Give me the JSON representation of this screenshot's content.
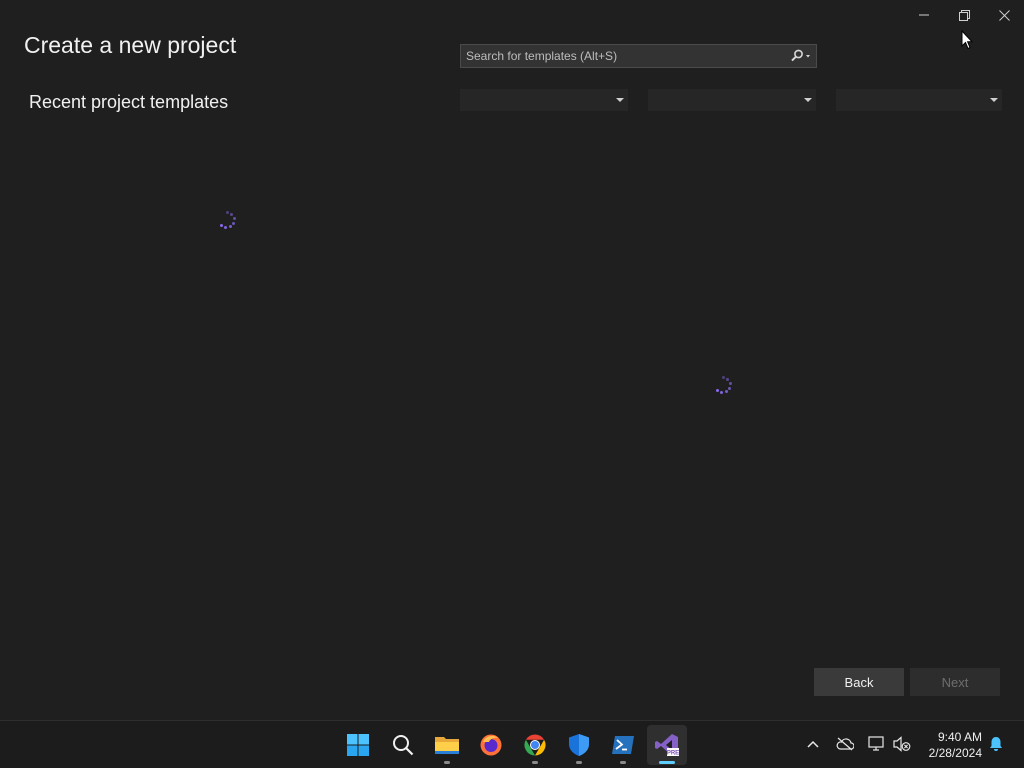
{
  "window": {
    "title": "Create a new project",
    "controls": {
      "minimize": "minimize-icon",
      "restore": "restore-icon",
      "close": "close-icon"
    }
  },
  "recent": {
    "heading": "Recent project templates"
  },
  "search": {
    "placeholder": "Search for templates (Alt+S)",
    "value": ""
  },
  "filters": [
    {
      "name": "language-filter",
      "selected": ""
    },
    {
      "name": "platform-filter",
      "selected": ""
    },
    {
      "name": "project-type-filter",
      "selected": ""
    }
  ],
  "buttons": {
    "back": "Back",
    "next": "Next"
  },
  "taskbar": {
    "apps": [
      "start-icon",
      "search-icon",
      "file-explorer-icon",
      "firefox-icon",
      "chrome-icon",
      "defender-icon",
      "powershell-icon",
      "visual-studio-preview-icon"
    ],
    "tray": [
      "chevron-up-icon",
      "onedrive-offline-icon",
      "network-icon",
      "volume-muted-icon",
      "notification-bell-icon"
    ],
    "time": "9:40 AM",
    "date": "2/28/2024"
  },
  "colors": {
    "background": "#1f1f1f",
    "accent": "#8a6cf0",
    "taskbar_indicator": "#60cdff"
  }
}
